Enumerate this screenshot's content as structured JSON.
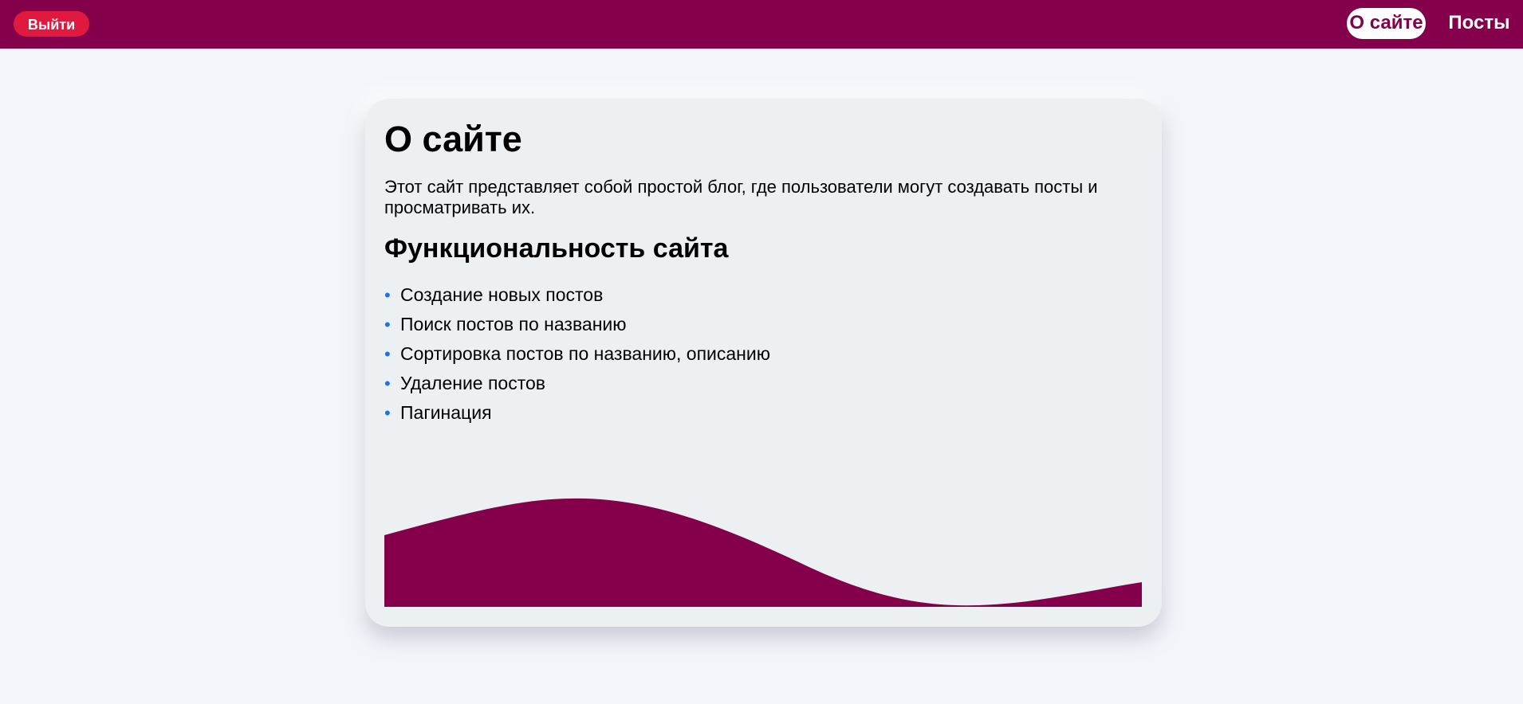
{
  "header": {
    "logout_label": "Выйти",
    "nav": {
      "about": "О сайте",
      "posts": "Посты"
    }
  },
  "about": {
    "title": "О сайте",
    "description": "Этот сайт представляет собой простой блог, где пользователи могут создавать посты и просматривать их.",
    "features_title": "Функциональность сайта",
    "features": [
      "Создание новых постов",
      "Поиск постов по названию",
      "Сортировка постов по названию, описанию",
      "Удаление постов",
      "Пагинация"
    ]
  },
  "colors": {
    "brand": "#84004b",
    "logout": "#e0193f",
    "bullet": "#1a73e8",
    "card_bg": "#edf0f3",
    "page_bg": "#f3f5fb"
  },
  "icons": {
    "wave": "wave-decoration"
  }
}
